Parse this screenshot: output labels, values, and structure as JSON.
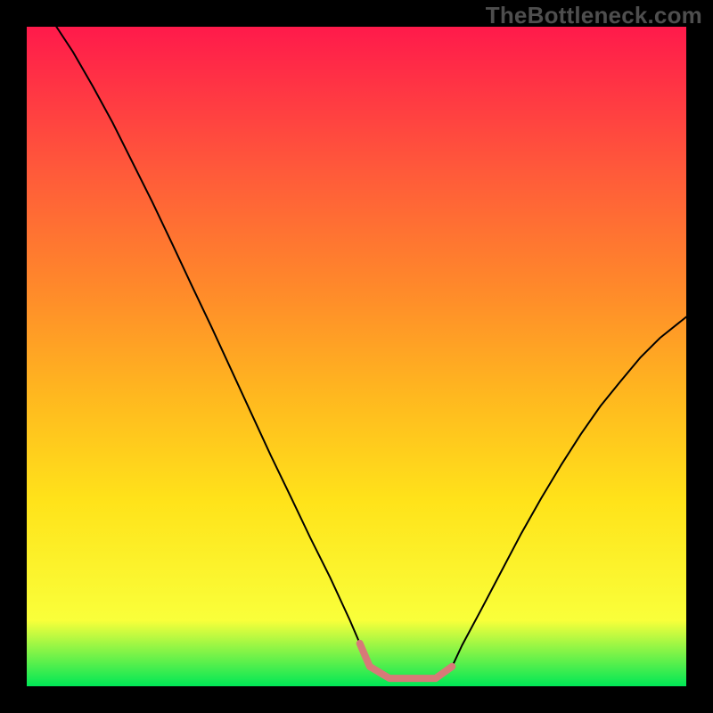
{
  "watermark": "TheBottleneck.com",
  "chart_data": {
    "type": "line",
    "title": "",
    "xlabel": "",
    "ylabel": "",
    "xlim": [
      0,
      1
    ],
    "ylim": [
      0,
      1
    ],
    "gradient_colors": [
      "#ff1a4b",
      "#ff5a3a",
      "#ff8a2a",
      "#ffb81f",
      "#ffe31a",
      "#f9ff3a",
      "#00e756"
    ],
    "gradient_stops": [
      0.0,
      0.22,
      0.4,
      0.56,
      0.72,
      0.9,
      1.0
    ],
    "series": [
      {
        "name": "curve",
        "color": "#000000",
        "width": 2,
        "x": [
          0.045,
          0.07,
          0.1,
          0.13,
          0.16,
          0.19,
          0.22,
          0.25,
          0.28,
          0.31,
          0.34,
          0.37,
          0.4,
          0.43,
          0.46,
          0.49,
          0.505,
          0.52,
          0.55,
          0.58,
          0.6,
          0.62,
          0.645,
          0.66,
          0.69,
          0.72,
          0.75,
          0.78,
          0.81,
          0.84,
          0.87,
          0.9,
          0.93,
          0.96,
          1.0
        ],
        "y": [
          1.0,
          0.962,
          0.91,
          0.855,
          0.795,
          0.735,
          0.672,
          0.608,
          0.545,
          0.48,
          0.415,
          0.35,
          0.288,
          0.225,
          0.165,
          0.1,
          0.065,
          0.03,
          0.012,
          0.012,
          0.012,
          0.012,
          0.03,
          0.062,
          0.118,
          0.175,
          0.232,
          0.285,
          0.335,
          0.382,
          0.425,
          0.462,
          0.498,
          0.528,
          0.56
        ]
      },
      {
        "name": "valley-band",
        "color": "#d77a78",
        "width": 8,
        "x": [
          0.505,
          0.52,
          0.55,
          0.58,
          0.6,
          0.62,
          0.645
        ],
        "y": [
          0.065,
          0.03,
          0.012,
          0.012,
          0.012,
          0.012,
          0.03
        ]
      }
    ]
  }
}
